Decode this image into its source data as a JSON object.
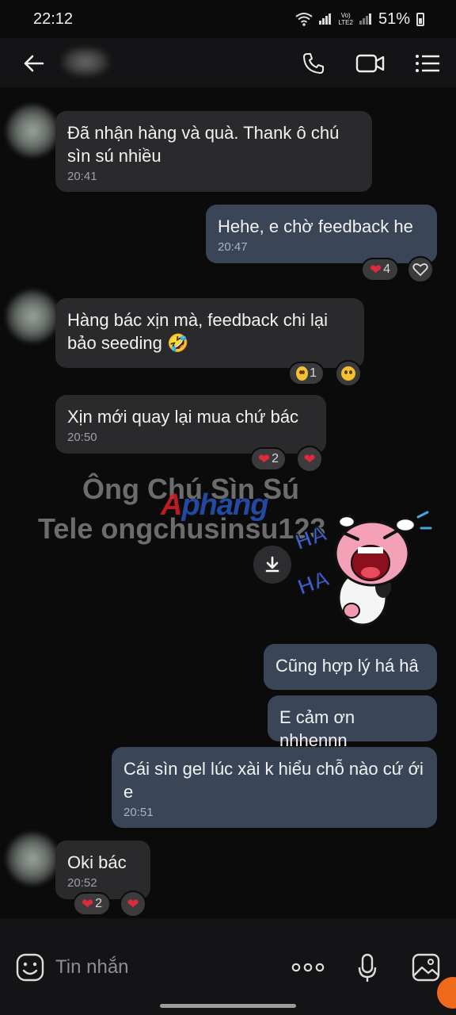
{
  "status_bar": {
    "time": "22:12",
    "network_label": "Vo)\nLTE2",
    "battery": "51%"
  },
  "header": {
    "back_icon": "arrow-left-icon",
    "actions": [
      "phone-icon",
      "video-call-icon",
      "menu-icon"
    ]
  },
  "messages": [
    {
      "side": "in",
      "text": "Đã nhận hàng và quà. Thank ô chú sìn sú nhiều",
      "time": "20:41"
    },
    {
      "side": "out",
      "text": "Hehe, e chờ feedback he",
      "time": "20:47",
      "reaction": {
        "emoji": "heart",
        "count": "4"
      }
    },
    {
      "side": "in",
      "text": "Hàng bác xịn mà, feedback chi lại bảo seeding 🤣",
      "time": "",
      "reaction": {
        "emoji": "flushed-face",
        "count": "1"
      }
    },
    {
      "side": "in",
      "text": "Xịn mới quay lại mua chứ bác",
      "time": "20:50",
      "reaction": {
        "emoji": "heart",
        "count": "2"
      }
    },
    {
      "side": "in",
      "type": "sticker",
      "sticker": "laughing-cow-haha-sticker"
    },
    {
      "side": "out",
      "text": "Cũng hợp lý há hâ",
      "time": ""
    },
    {
      "side": "out",
      "text": "E cảm ơn nhhennn",
      "time": ""
    },
    {
      "side": "out",
      "text": "Cái sìn gel lúc xài k hiểu chỗ nào cứ ới e",
      "time": "20:51"
    },
    {
      "side": "in",
      "text": "Oki bác",
      "time": "20:52",
      "reaction": {
        "emoji": "heart",
        "count": "2"
      }
    }
  ],
  "watermark": {
    "line1": "Ông Chú Sìn Sú",
    "line2": "Tele ongchusinsu123",
    "brand_a": "A",
    "brand_rest": "phang"
  },
  "sticker_text": "HA HA",
  "input": {
    "placeholder": "Tin nhắn",
    "icons": [
      "emoji-icon",
      "more-icon",
      "microphone-icon",
      "image-icon"
    ]
  },
  "colors": {
    "incoming_bubble": "#2a2a2d",
    "outgoing_bubble": "#3a4658",
    "heart": "#e02a3c"
  }
}
